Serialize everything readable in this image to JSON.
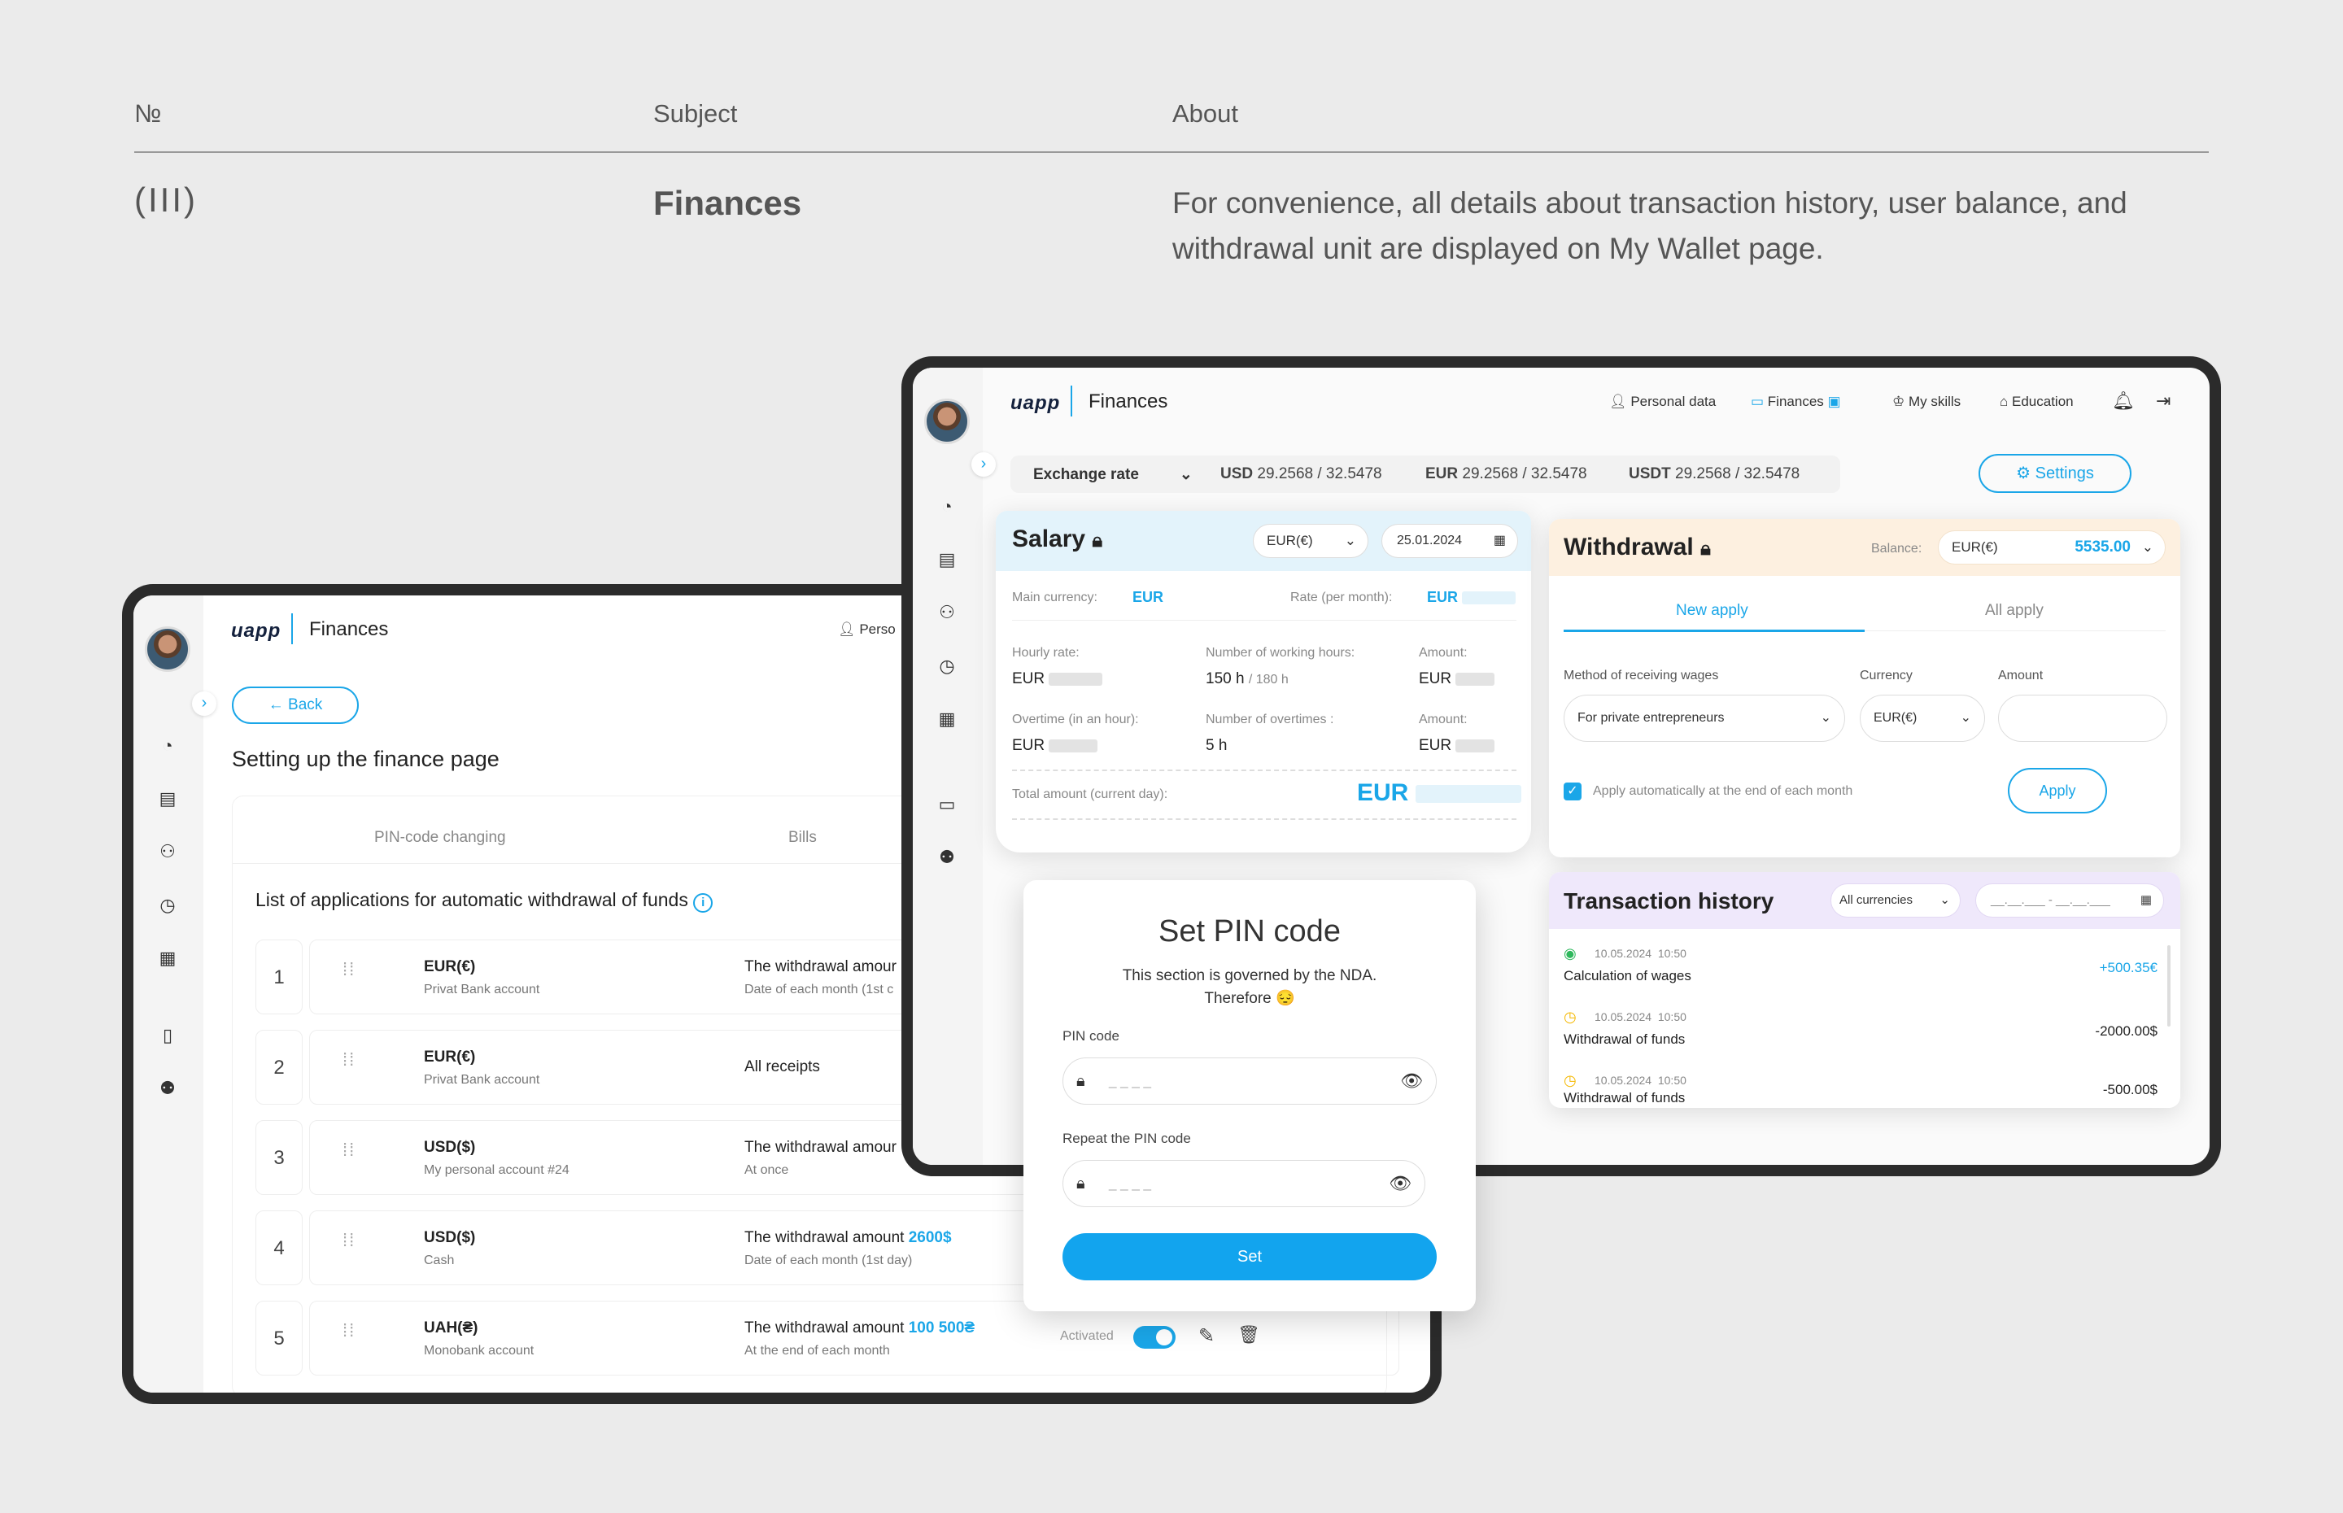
{
  "header": {
    "col_number": "№",
    "col_subject": "Subject",
    "col_about": "About"
  },
  "row": {
    "number": "(III)",
    "subject": "Finances",
    "about": "For convenience, all details about transaction history, user balance, and withdrawal unit are displayed on My Wallet page."
  },
  "left_device": {
    "logo": "uapp",
    "title": "Finances",
    "nav_personal": "Perso",
    "back_label": "Back",
    "page_title": "Setting up the finance page",
    "tabs": [
      "PIN-code changing",
      "Bills"
    ],
    "list_title": "List of applications for automatic withdrawal of funds",
    "rows": [
      {
        "n": "1",
        "title": "EUR(€)",
        "sub": "Privat Bank account",
        "main": "The withdrawal amour",
        "main_sub": "Date of each month (1st c"
      },
      {
        "n": "2",
        "title": "EUR(€)",
        "sub": "Privat Bank account",
        "main": "All receipts",
        "main_sub": ""
      },
      {
        "n": "3",
        "title": "USD($)",
        "sub": "My personal account #24",
        "main": "The withdrawal amour",
        "main_sub": "At once"
      },
      {
        "n": "4",
        "title": "USD($)",
        "sub": "Cash",
        "main": "The withdrawal amount",
        "amount": "2600$",
        "main_sub": "Date of each month (1st day)"
      },
      {
        "n": "5",
        "title": "UAH(₴)",
        "sub": "Monobank account",
        "main": "The withdrawal amount",
        "amount": "100 500₴",
        "main_sub": "At the end of each month",
        "status": "Activated"
      }
    ]
  },
  "right_device": {
    "logo": "uapp",
    "title": "Finances",
    "nav": {
      "personal": "Personal data",
      "finances": "Finances",
      "skills": "My skills",
      "education": "Education"
    },
    "exchange": {
      "label": "Exchange rate",
      "usd_label": "USD",
      "usd": "29.2568 / 32.5478",
      "eur_label": "EUR",
      "eur": "29.2568 / 32.5478",
      "usdt_label": "USDT",
      "usdt": "29.2568 / 32.5478"
    },
    "settings_label": "Settings",
    "salary": {
      "title": "Salary",
      "currency": "EUR(€)",
      "date": "25.01.2024",
      "main_currency_label": "Main currency:",
      "main_currency": "EUR",
      "rate_label": "Rate (per month):",
      "rate_currency": "EUR",
      "hourly_label": "Hourly rate:",
      "hourly_currency": "EUR",
      "hours_label": "Number of working hours:",
      "hours": "150 h",
      "hours_total": "/ 180 h",
      "amount_label": "Amount:",
      "amount_currency": "EUR",
      "overtime_label": "Overtime (in an hour):",
      "overtime_currency": "EUR",
      "overtimes_label": "Number of overtimes :",
      "overtimes": "5 h",
      "amount2_label": "Amount:",
      "amount2_currency": "EUR",
      "total_label": "Total amount (current day):",
      "total_currency": "EUR"
    },
    "withdrawal": {
      "title": "Withdrawal",
      "balance_label": "Balance:",
      "balance_currency": "EUR(€)",
      "balance": "5535.00",
      "tab_new": "New apply",
      "tab_all": "All apply",
      "method_label": "Method of receiving wages",
      "method_value": "For private entrepreneurs",
      "currency_label": "Currency",
      "currency_value": "EUR(€)",
      "amount_label": "Amount",
      "auto_label": "Apply automatically at the end of each month",
      "apply_label": "Apply"
    },
    "history": {
      "title": "Transaction history",
      "filter": "All currencies",
      "date_range": "__.__.___ - __.__.___",
      "items": [
        {
          "date": "10.05.2024",
          "time": "10:50",
          "label": "Calculation of wages",
          "amount": "+500.35€",
          "status": "done"
        },
        {
          "date": "10.05.2024",
          "time": "10:50",
          "label": "Withdrawal of funds",
          "amount": "-2000.00$",
          "status": "pending"
        },
        {
          "date": "10.05.2024",
          "time": "10:50",
          "label": "Withdrawal of funds",
          "amount": "-500.00$",
          "status": "pending"
        }
      ]
    }
  },
  "pin_modal": {
    "title": "Set PIN code",
    "desc_line1": "This section is governed by the NDA.",
    "desc_line2": "Therefore 😔",
    "pin_label": "PIN code",
    "pin_placeholder": "_ _ _ _",
    "repeat_label": "Repeat the PIN code",
    "repeat_placeholder": "_ _ _ _",
    "set_label": "Set"
  },
  "colors": {
    "accent": "#1aa6e8",
    "salary_bg": "#e3f3fb",
    "withdrawal_bg": "#fdf0e0",
    "history_bg": "#efe8fb"
  }
}
